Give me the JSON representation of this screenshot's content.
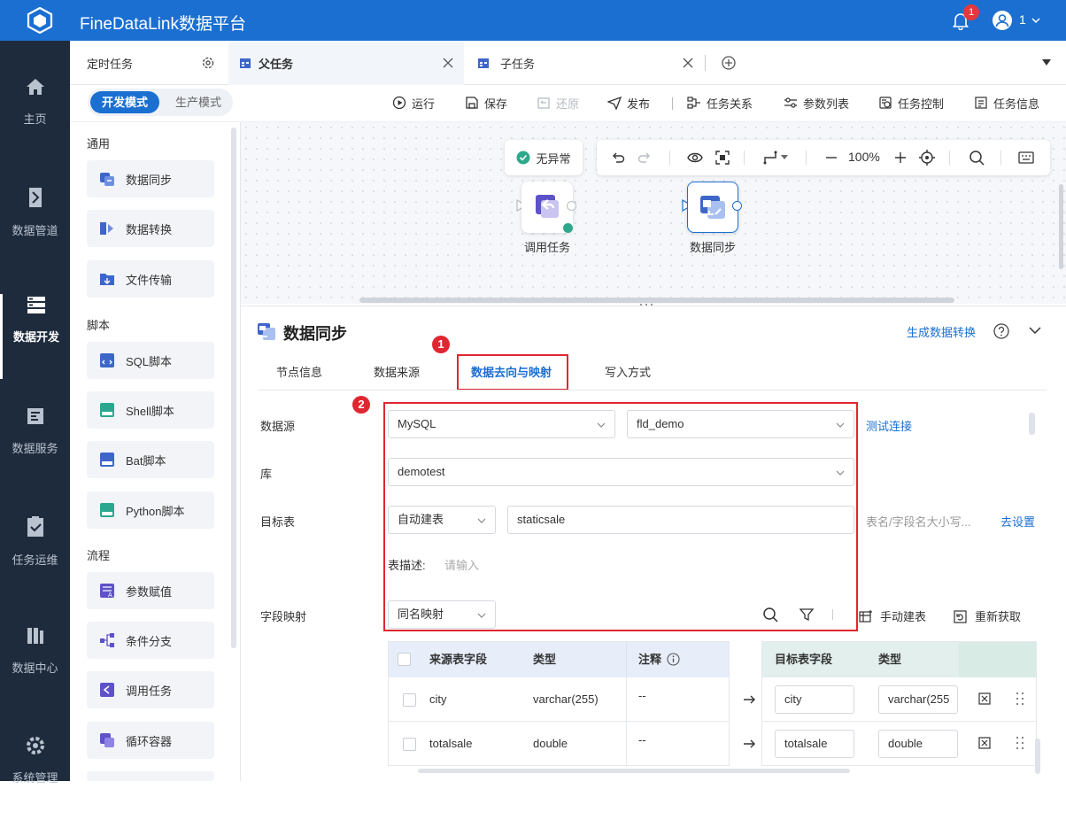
{
  "app": {
    "title": "FineDataLink数据平台",
    "notifications": "1",
    "user": "1"
  },
  "nav": [
    {
      "label": "主页"
    },
    {
      "label": "数据管道"
    },
    {
      "label": "数据开发"
    },
    {
      "label": "数据服务"
    },
    {
      "label": "任务运维"
    },
    {
      "label": "数据中心"
    },
    {
      "label": "系统管理"
    }
  ],
  "tabs": {
    "scheduled": "定时任务",
    "parent": "父任务",
    "child": "子任务"
  },
  "modes": {
    "dev": "开发模式",
    "prod": "生产模式"
  },
  "toolbar": {
    "run": "运行",
    "save": "保存",
    "restore": "还原",
    "publish": "发布",
    "relation": "任务关系",
    "params": "参数列表",
    "control": "任务控制",
    "info": "任务信息"
  },
  "palette": {
    "groups": [
      "通用",
      "脚本",
      "流程"
    ],
    "items": [
      "数据同步",
      "数据转换",
      "文件传输",
      "SQL脚本",
      "Shell脚本",
      "Bat脚本",
      "Python脚本",
      "参数赋值",
      "条件分支",
      "调用任务",
      "循环容器"
    ]
  },
  "canvas": {
    "status": "无异常",
    "zoom": "100%",
    "node1": "调用任务",
    "node2": "数据同步"
  },
  "panel": {
    "title": "数据同步",
    "gen_link": "生成数据转换",
    "tabs": [
      "节点信息",
      "数据来源",
      "数据去向与映射",
      "写入方式"
    ],
    "callouts": [
      "1",
      "2"
    ],
    "form": {
      "datasource_label": "数据源",
      "datasource_type": "MySQL",
      "connection": "fld_demo",
      "test_link": "测试连接",
      "db_label": "库",
      "db": "demotest",
      "target_label": "目标表",
      "target_mode": "自动建表",
      "target_table": "staticsale",
      "case_placeholder": "表名/字段名大小写...",
      "goto_settings": "去设置",
      "desc_label": "表描述:",
      "desc_placeholder": "请输入",
      "mapping_label": "字段映射",
      "mapping_mode": "同名映射",
      "manual_build": "手动建表",
      "refetch": "重新获取"
    },
    "source_table": {
      "headers": [
        "来源表字段",
        "类型",
        "注释"
      ],
      "rows": [
        {
          "field": "city",
          "type": "varchar(255)",
          "comment": "--"
        },
        {
          "field": "totalsale",
          "type": "double",
          "comment": "--"
        }
      ]
    },
    "target_table": {
      "headers": [
        "目标表字段",
        "类型"
      ],
      "rows": [
        {
          "field": "city",
          "type": "varchar(255"
        },
        {
          "field": "totalsale",
          "type": "double"
        }
      ]
    }
  },
  "colors": {
    "brand": "#1b6fd1",
    "nav_bg": "#1e2b3c",
    "highlight": "#e02731"
  }
}
